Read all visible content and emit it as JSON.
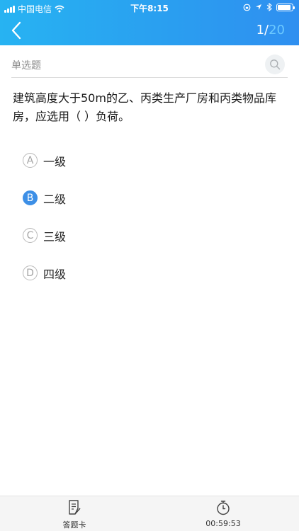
{
  "status_bar": {
    "carrier": "中国电信",
    "time": "下午8:15"
  },
  "nav": {
    "current": "1",
    "separator": "/",
    "total": "20"
  },
  "question": {
    "type": "单选题",
    "text": "建筑高度大于50m的乙、丙类生产厂房和丙类物品库房，应选用（ ）负荷。",
    "selected": "B",
    "options": [
      {
        "letter": "A",
        "text": "一级"
      },
      {
        "letter": "B",
        "text": "二级"
      },
      {
        "letter": "C",
        "text": "三级"
      },
      {
        "letter": "D",
        "text": "四级"
      }
    ]
  },
  "bottom_bar": {
    "answer_card_label": "答题卡",
    "timer": "00:59:53"
  },
  "colors": {
    "header_start": "#27b3f2",
    "header_end": "#2f8ff0",
    "selected": "#3d8fe6",
    "total_count": "#6cc9ff"
  }
}
